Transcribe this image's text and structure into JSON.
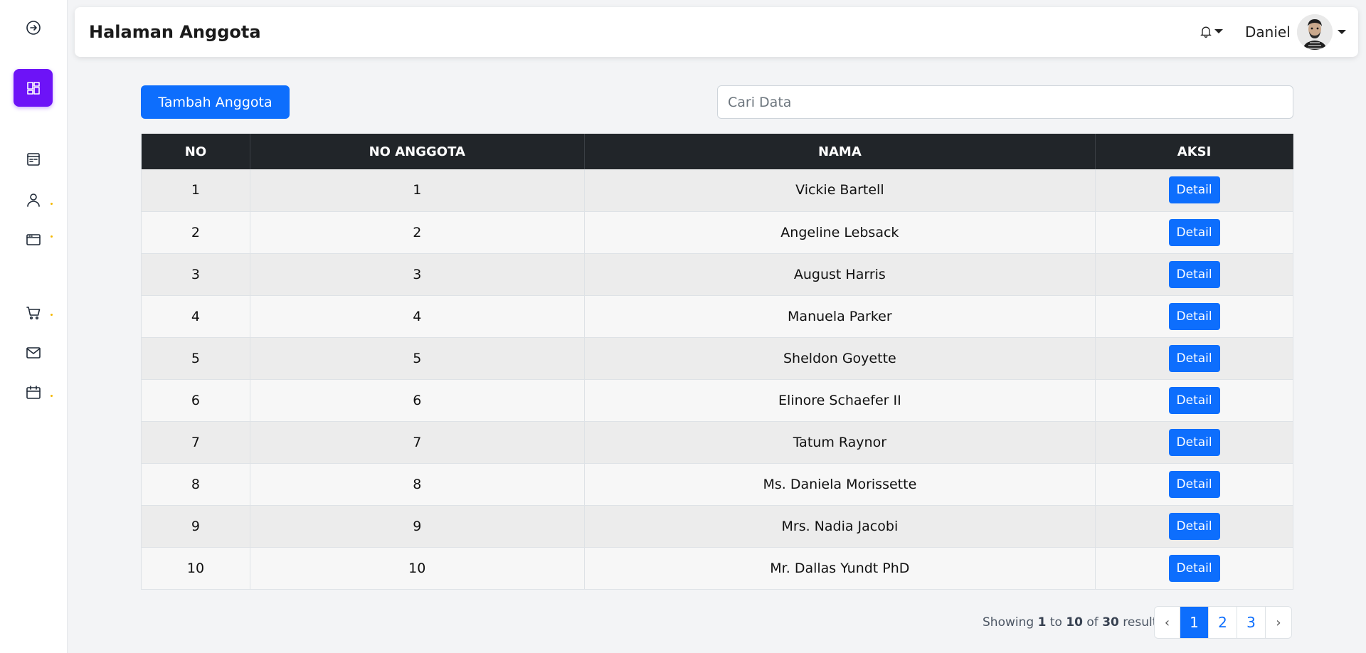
{
  "header": {
    "title": "Halaman Anggota",
    "user_name": "Daniel"
  },
  "toolbar": {
    "add_label": "Tambah Anggota",
    "search_placeholder": "Cari Data"
  },
  "sidebar": {
    "items": [
      {
        "icon": "arrow-circle-right-icon",
        "active": false
      },
      {
        "icon": "dashboard-grid-icon",
        "active": true
      },
      {
        "icon": "document-list-icon",
        "active": false
      },
      {
        "icon": "user-icon",
        "active": false
      },
      {
        "icon": "browser-window-icon",
        "active": false
      },
      {
        "icon": "cart-icon",
        "active": false
      },
      {
        "icon": "mail-icon",
        "active": false
      },
      {
        "icon": "calendar-icon",
        "active": false
      }
    ],
    "accent_color": "#6d13f7",
    "dot_color": "#f5b800"
  },
  "table": {
    "columns": [
      "NO",
      "NO ANGGOTA",
      "NAMA",
      "AKSI"
    ],
    "action_label": "Detail",
    "rows": [
      {
        "no": "1",
        "no_anggota": "1",
        "nama": "Vickie Bartell"
      },
      {
        "no": "2",
        "no_anggota": "2",
        "nama": "Angeline Lebsack"
      },
      {
        "no": "3",
        "no_anggota": "3",
        "nama": "August Harris"
      },
      {
        "no": "4",
        "no_anggota": "4",
        "nama": "Manuela Parker"
      },
      {
        "no": "5",
        "no_anggota": "5",
        "nama": "Sheldon Goyette"
      },
      {
        "no": "6",
        "no_anggota": "6",
        "nama": "Elinore Schaefer II"
      },
      {
        "no": "7",
        "no_anggota": "7",
        "nama": "Tatum Raynor"
      },
      {
        "no": "8",
        "no_anggota": "8",
        "nama": "Ms. Daniela Morissette"
      },
      {
        "no": "9",
        "no_anggota": "9",
        "nama": "Mrs. Nadia Jacobi"
      },
      {
        "no": "10",
        "no_anggota": "10",
        "nama": "Mr. Dallas Yundt PhD"
      }
    ]
  },
  "pagination": {
    "showing_prefix": "Showing",
    "from": "1",
    "to_word": "to",
    "to": "10",
    "of_word": "of",
    "total": "30",
    "results_word": "results",
    "prev": "‹",
    "next": "›",
    "pages": [
      "1",
      "2",
      "3"
    ],
    "current": "1"
  },
  "colors": {
    "primary": "#0d6efd",
    "table_header": "#212529"
  }
}
